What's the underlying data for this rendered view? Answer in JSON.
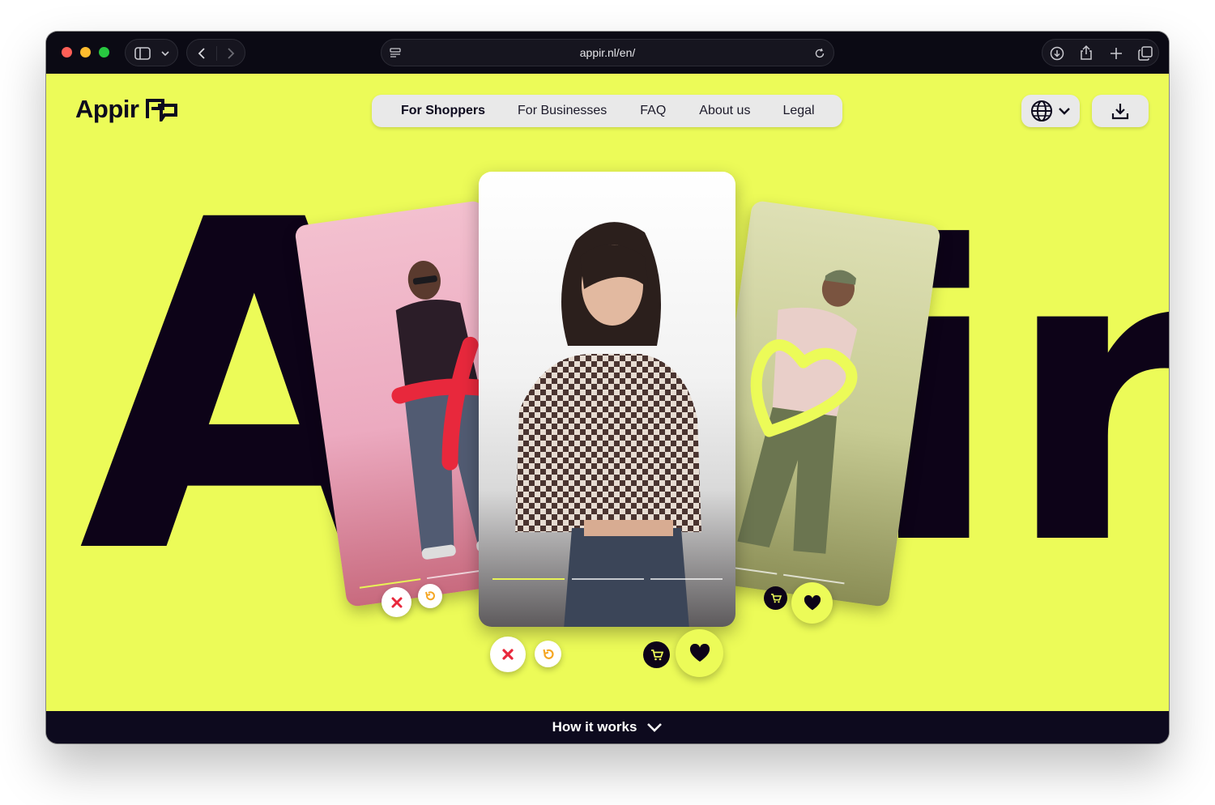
{
  "browser": {
    "url": "appir.nl/en/"
  },
  "header": {
    "logo_text": "Appir",
    "nav": [
      {
        "label": "For Shoppers",
        "active": true
      },
      {
        "label": "For Businesses",
        "active": false
      },
      {
        "label": "FAQ",
        "active": false
      },
      {
        "label": "About us",
        "active": false
      },
      {
        "label": "Legal",
        "active": false
      }
    ]
  },
  "hero": {
    "big_left": "A",
    "big_right": "ir"
  },
  "footer_bar": {
    "label": "How it works"
  },
  "colors": {
    "background": "#ecfb58",
    "ink": "#0d0318",
    "accent_red": "#e8283c",
    "accent_orange": "#f5a623"
  }
}
